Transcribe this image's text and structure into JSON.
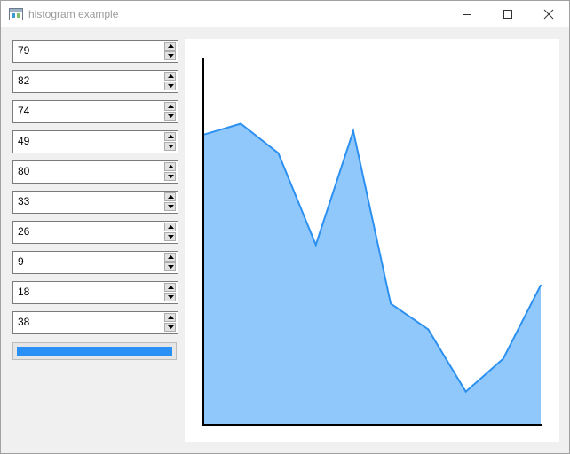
{
  "window": {
    "title": "histogram example",
    "icon": "app-window-icon",
    "controls": [
      "minimize-icon",
      "maximize-icon",
      "close-icon"
    ]
  },
  "spinboxes": [
    {
      "value": "79"
    },
    {
      "value": "82"
    },
    {
      "value": "74"
    },
    {
      "value": "49"
    },
    {
      "value": "80"
    },
    {
      "value": "33"
    },
    {
      "value": "26"
    },
    {
      "value": "9"
    },
    {
      "value": "18"
    },
    {
      "value": "38"
    }
  ],
  "progress": {
    "value": 1.0
  },
  "colors": {
    "area_fill": "#90c8fc",
    "line": "#2b90f0",
    "axis": "#000000",
    "progress": "#2b90f5"
  },
  "chart_data": {
    "type": "area",
    "x": [
      1,
      2,
      3,
      4,
      5,
      6,
      7,
      8,
      9,
      10
    ],
    "values": [
      79,
      82,
      74,
      49,
      80,
      33,
      26,
      9,
      18,
      38
    ],
    "ylim": [
      0,
      100
    ],
    "grid": false
  }
}
